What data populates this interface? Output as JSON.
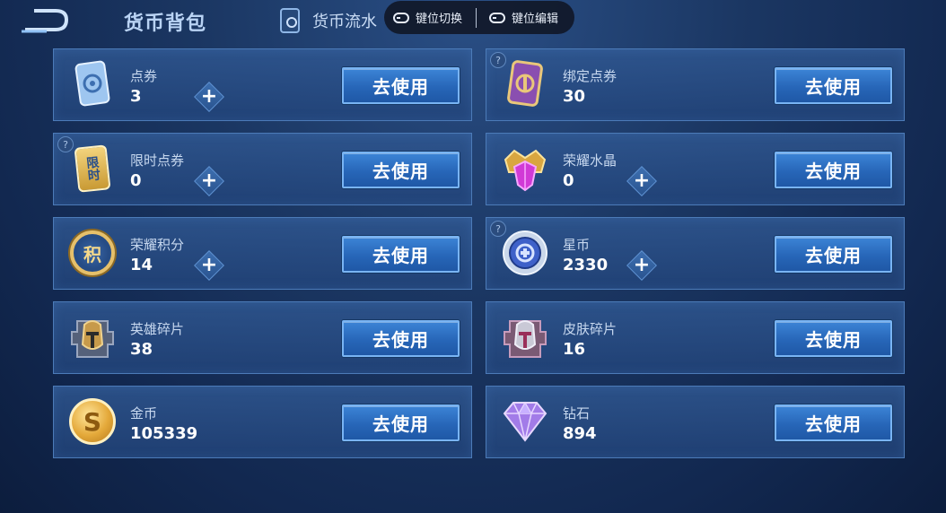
{
  "header": {
    "title": "货币背包",
    "flow_tab": "货币流水",
    "key_switch": "键位切换",
    "key_edit": "键位编辑"
  },
  "use_label": "去使用",
  "items": [
    {
      "name": "点券",
      "amount": "3"
    },
    {
      "name": "绑定点券",
      "amount": "30"
    },
    {
      "name": "限时点券",
      "amount": "0"
    },
    {
      "name": "荣耀水晶",
      "amount": "0"
    },
    {
      "name": "荣耀积分",
      "amount": "14"
    },
    {
      "name": "星币",
      "amount": "2330"
    },
    {
      "name": "英雄碎片",
      "amount": "38"
    },
    {
      "name": "皮肤碎片",
      "amount": "16"
    },
    {
      "name": "金币",
      "amount": "105339"
    },
    {
      "name": "钻石",
      "amount": "894"
    }
  ],
  "icons": {
    "voucher": "voucher-card-icon",
    "bound_voucher": "bound-voucher-card-icon",
    "limited_voucher": "limited-voucher-icon",
    "crystal": "honor-crystal-icon",
    "points": "honor-points-icon",
    "star_coin": "star-coin-icon",
    "hero_shard": "hero-shard-icon",
    "skin_shard": "skin-shard-icon",
    "gold": "gold-coin-icon",
    "diamond": "diamond-icon"
  },
  "limited_badge": "限时",
  "points_badge": "积",
  "gold_badge": "S",
  "help_mark": "?",
  "plus_mark": "+"
}
